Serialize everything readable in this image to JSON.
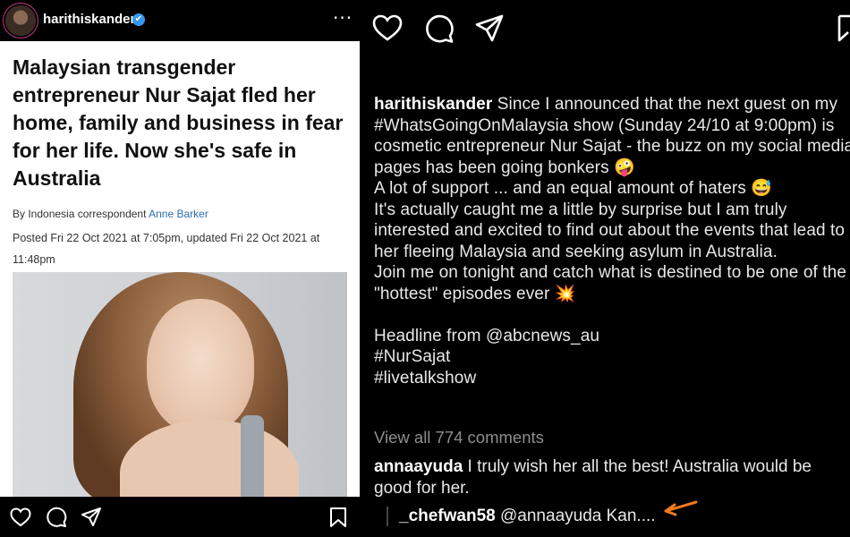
{
  "post": {
    "username": "harithiskander",
    "verified_badge": "✔",
    "more_label": "···",
    "article": {
      "headline": "Malaysian transgender entrepreneur Nur Sajat fled her home, family and business in fear for her life. Now she's safe in Australia",
      "byline_prefix": "By Indonesia correspondent ",
      "byline_author": "Anne Barker",
      "posted": "Posted Fri 22 Oct 2021 at 7:05pm, updated Fri 22 Oct 2021 at 11:48pm"
    }
  },
  "caption": {
    "username": "harithiskander",
    "text": " Since I announced that the next guest on my #WhatsGoingOnMalaysia show (Sunday 24/10 at 9:00pm) is cosmetic entrepreneur Nur Sajat - the buzz on my social media pages has been going bonkers 🤪\nA lot of support ... and an equal amount of haters 😅\nIt's actually caught me a little by surprise but I am truly interested and excited to find out about the events that lead to her fleeing Malaysia and seeking asylum in Australia.\nJoin me on tonight and catch what is destined to be one of the \"hottest\" episodes ever 💥\n\nHeadline from @abcnews_au\n#NurSajat\n#livetalkshow"
  },
  "comments": {
    "view_all": "View all 774 comments",
    "top": {
      "username": "annaayuda",
      "text": " I truly wish her all the best! Australia would be good for her."
    },
    "reply": {
      "username": "_chefwan58",
      "text": " @annaayuda Kan...."
    }
  },
  "colors": {
    "accent_arrow": "#f07a1f",
    "verified": "#3897f0",
    "link_author": "#2a6db0"
  },
  "icons": [
    "heart-icon",
    "comment-icon",
    "share-icon",
    "bookmark-icon",
    "more-icon",
    "verified-icon",
    "arrow-icon"
  ]
}
